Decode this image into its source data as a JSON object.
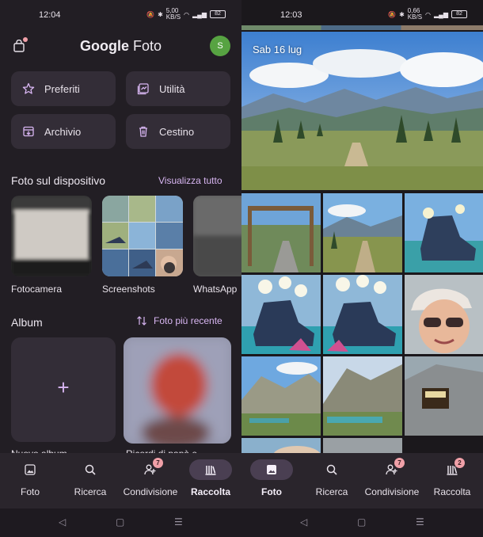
{
  "left": {
    "status": {
      "time": "12:04",
      "speed": "5,00\nKB/S",
      "battery": "82"
    },
    "app_title_prefix": "Google",
    "app_title_suffix": "Foto",
    "avatar_letter": "S",
    "tiles": [
      {
        "label": "Preferiti",
        "icon": "star-icon"
      },
      {
        "label": "Utilità",
        "icon": "utility-icon"
      },
      {
        "label": "Archivio",
        "icon": "archive-icon"
      },
      {
        "label": "Cestino",
        "icon": "trash-icon"
      }
    ],
    "device_section": {
      "title": "Foto sul dispositivo",
      "link": "Visualizza tutto"
    },
    "device_folders": [
      {
        "label": "Fotocamera"
      },
      {
        "label": "Screenshots"
      },
      {
        "label": "WhatsApp"
      }
    ],
    "album_section": {
      "title": "Album",
      "sort_label": "Foto più recente"
    },
    "albums": [
      {
        "label": "Nuovo album"
      },
      {
        "label": "Ricordi di papà e"
      }
    ],
    "nav": [
      {
        "label": "Foto",
        "icon": "photo-icon",
        "badge": ""
      },
      {
        "label": "Ricerca",
        "icon": "search-icon",
        "badge": ""
      },
      {
        "label": "Condivisione",
        "icon": "sharing-icon",
        "badge": "7"
      },
      {
        "label": "Raccolta",
        "icon": "library-icon",
        "badge": ""
      }
    ],
    "active_nav": "Raccolta"
  },
  "right": {
    "status": {
      "time": "12:03",
      "speed": "0,66\nKB/S",
      "battery": "82"
    },
    "date_label": "Sab 16 lug",
    "nav": [
      {
        "label": "Foto",
        "icon": "photo-icon",
        "badge": ""
      },
      {
        "label": "Ricerca",
        "icon": "search-icon",
        "badge": ""
      },
      {
        "label": "Condivisione",
        "icon": "sharing-icon",
        "badge": "7"
      },
      {
        "label": "Raccolta",
        "icon": "library-icon",
        "badge": "2"
      }
    ],
    "active_nav": "Foto"
  },
  "colors": {
    "accent": "#d8b6f2",
    "surface": "#332d37",
    "active_pill": "#4a3f52",
    "badge": "#f0a0a8",
    "avatar": "#57a342"
  }
}
